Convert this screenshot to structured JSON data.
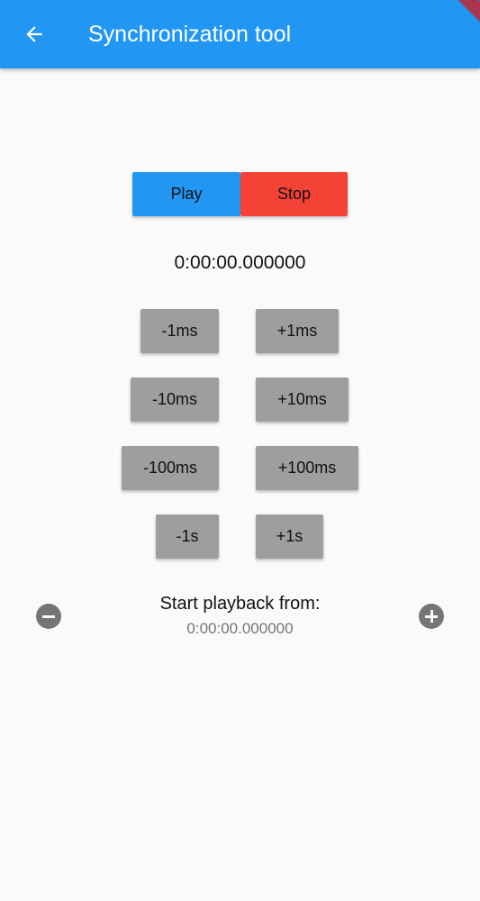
{
  "appbar": {
    "title": "Synchronization tool",
    "back_icon": "arrow-left-icon",
    "color": "#2196f3"
  },
  "controls": {
    "play_label": "Play",
    "stop_label": "Stop",
    "play_color": "#2196f3",
    "stop_color": "#f44336"
  },
  "timer": {
    "value": "0:00:00.000000"
  },
  "adjust": {
    "minus_1ms": "-1ms",
    "plus_1ms": "+1ms",
    "minus_10ms": "-10ms",
    "plus_10ms": "+10ms",
    "minus_100ms": "-100ms",
    "plus_100ms": "+100ms",
    "minus_1s": "-1s",
    "plus_1s": "+1s"
  },
  "playback": {
    "label": "Start playback from:",
    "value": "0:00:00.000000",
    "decrease_icon": "minus-circle-icon",
    "increase_icon": "plus-circle-icon"
  }
}
